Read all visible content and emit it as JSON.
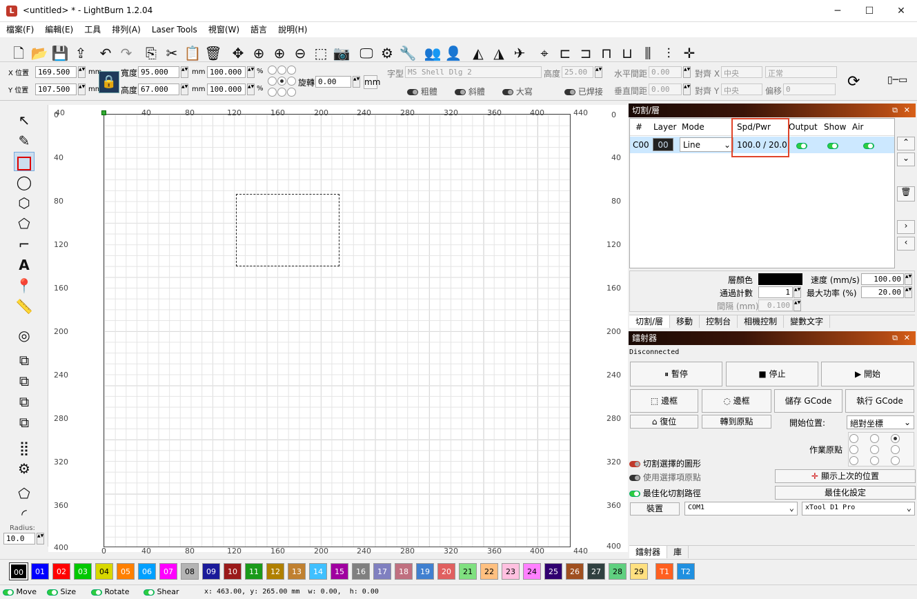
{
  "window": {
    "title": "<untitled> * - LightBurn 1.2.04",
    "minimize": "─",
    "maximize": "☐",
    "close": "✕"
  },
  "menu": [
    "檔案(F)",
    "編輯(E)",
    "工具",
    "排列(A)",
    "Laser Tools",
    "視窗(W)",
    "語言",
    "說明(H)"
  ],
  "props": {
    "x_label": "X 位置",
    "x_value": "169.500",
    "y_label": "Y 位置",
    "y_value": "107.500",
    "unit": "mm",
    "width_label": "寬度",
    "width_value": "95.000",
    "height_label": "高度",
    "height_value": "67.000",
    "w_pct": "100.000",
    "h_pct": "100.000",
    "pct": "%",
    "rotate_label": "旋轉",
    "rotate_value": "0.00",
    "rotate_unit": "mm"
  },
  "text_props": {
    "font_label": "字型",
    "font_value": "MS Shell Dlg 2",
    "height_label": "高度",
    "height_value": "25.00",
    "hspace_label": "水平間距",
    "hspace_value": "0.00",
    "align_x_label": "對齊 X",
    "align_x_value": "中央",
    "style_value": "正常",
    "vspace_label": "垂直間距",
    "vspace_value": "0.00",
    "align_y_label": "對齊 Y",
    "align_y_value": "中央",
    "offset_label": "偏移",
    "offset_value": "0",
    "bold": "粗體",
    "italic": "斜體",
    "upper": "大寫",
    "welded": "已焊接"
  },
  "ruler": {
    "top": [
      "0",
      "40",
      "80",
      "120",
      "160",
      "200",
      "240",
      "280",
      "320",
      "360",
      "400",
      "440"
    ],
    "top_first": "40",
    "left": [
      "0",
      "40",
      "80",
      "120",
      "160",
      "200",
      "240",
      "280",
      "320",
      "360",
      "400"
    ],
    "bottom": [
      "0",
      "40",
      "80",
      "120",
      "160",
      "200",
      "240",
      "280",
      "320",
      "360",
      "400",
      "440"
    ],
    "right": [
      "0",
      "40",
      "80",
      "120",
      "160",
      "200",
      "240",
      "280",
      "320",
      "360",
      "400"
    ]
  },
  "left_tools": {
    "radius_label": "Radius:",
    "radius_value": "10.0"
  },
  "cuts_panel": {
    "title": "切割/層",
    "columns": [
      "#",
      "Layer",
      "Mode",
      "Spd/Pwr",
      "Output",
      "Show",
      "Air"
    ],
    "row": {
      "num": "C00",
      "layer": "00",
      "mode": "Line",
      "spd_pwr": "100.0 / 20.0"
    },
    "layer_color_label": "層顏色",
    "passes_label": "通過計數",
    "passes_value": "1",
    "interval_label": "間隔 (mm)",
    "interval_value": "0.100",
    "speed_label": "速度 (mm/s)",
    "speed_value": "100.00",
    "maxpower_label": "最大功率 (%)",
    "maxpower_value": "20.00",
    "tabs": [
      "切割/層",
      "移動",
      "控制台",
      "相機控制",
      "變數文字"
    ]
  },
  "laser_panel": {
    "title": "鐳射器",
    "status": "Disconnected",
    "pause": "暫停",
    "stop": "停止",
    "start": "開始",
    "frame1": "邊框",
    "frame2": "邊框",
    "save_gcode": "儲存 GCode",
    "run_gcode": "執行 GCode",
    "home": "復位",
    "goto_origin": "轉到原點",
    "start_from_label": "開始位置:",
    "start_from_value": "絕對坐標",
    "job_origin_label": "作業原點",
    "cut_selected": "切割選擇的圖形",
    "use_selection_origin": "使用選擇項原點",
    "show_last_position": "顯示上次的位置",
    "optimize_cut": "最佳化切割路徑",
    "optimize_settings": "最佳化設定",
    "devices": "裝置",
    "port": "COM1",
    "machine": "xTool D1 Pro",
    "tabs": [
      "鐳射器",
      "庫"
    ]
  },
  "palette": [
    {
      "label": "00",
      "color": "#000000"
    },
    {
      "label": "01",
      "color": "#0000ff"
    },
    {
      "label": "02",
      "color": "#ff0000"
    },
    {
      "label": "03",
      "color": "#00c800"
    },
    {
      "label": "04",
      "color": "#d8d800"
    },
    {
      "label": "05",
      "color": "#ff8000"
    },
    {
      "label": "06",
      "color": "#00a0ff"
    },
    {
      "label": "07",
      "color": "#ff00ff"
    },
    {
      "label": "08",
      "color": "#b4b4b4"
    },
    {
      "label": "09",
      "color": "#1a1a9a"
    },
    {
      "label": "10",
      "color": "#9a1a1a"
    },
    {
      "label": "11",
      "color": "#1a9a1a"
    },
    {
      "label": "12",
      "color": "#b08000"
    },
    {
      "label": "13",
      "color": "#c08030"
    },
    {
      "label": "14",
      "color": "#40c0ff"
    },
    {
      "label": "15",
      "color": "#a000a0"
    },
    {
      "label": "16",
      "color": "#808080"
    },
    {
      "label": "17",
      "color": "#8080c0"
    },
    {
      "label": "18",
      "color": "#c07080"
    },
    {
      "label": "19",
      "color": "#4080d0"
    },
    {
      "label": "20",
      "color": "#e06060"
    },
    {
      "label": "21",
      "color": "#80e080"
    },
    {
      "label": "22",
      "color": "#ffc080"
    },
    {
      "label": "23",
      "color": "#ffc0e0"
    },
    {
      "label": "24",
      "color": "#ff80ff"
    },
    {
      "label": "25",
      "color": "#300070"
    },
    {
      "label": "26",
      "color": "#a05020"
    },
    {
      "label": "27",
      "color": "#304040"
    },
    {
      "label": "28",
      "color": "#60d080"
    },
    {
      "label": "29",
      "color": "#ffe080"
    },
    {
      "label": "T1",
      "color": "#ff6020"
    },
    {
      "label": "T2",
      "color": "#2090e0"
    }
  ],
  "status": {
    "move": "Move",
    "size": "Size",
    "rotate": "Rotate",
    "shear": "Shear",
    "coords": "x: 463.00, y: 265.00 mm  w: 0.00,  h: 0.00"
  }
}
